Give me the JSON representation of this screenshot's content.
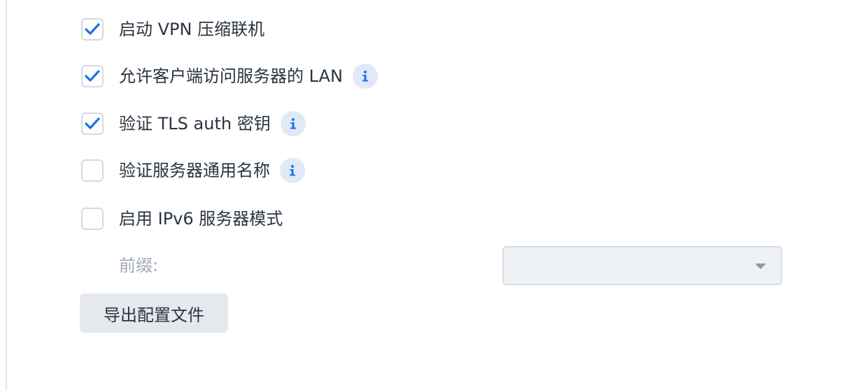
{
  "options": [
    {
      "label": "启动 VPN 压缩联机",
      "checked": true,
      "has_info": false
    },
    {
      "label": "允许客户端访问服务器的 LAN",
      "checked": true,
      "has_info": true
    },
    {
      "label": "验证 TLS auth 密钥",
      "checked": true,
      "has_info": true
    },
    {
      "label": "验证服务器通用名称",
      "checked": false,
      "has_info": true
    },
    {
      "label": "启用 IPv6 服务器模式",
      "checked": false,
      "has_info": false
    }
  ],
  "prefix": {
    "label": "前缀:",
    "value": ""
  },
  "export_button": {
    "label": "导出配置文件"
  },
  "icons": {
    "checkbox_tick": "check-icon",
    "info": "info-icon",
    "select_caret": "chevron-down-icon"
  },
  "colors": {
    "accent": "#1a73e8",
    "info_bg": "#dfe9f7",
    "button_bg": "#e5e9ee",
    "select_bg": "#eff2f5",
    "text": "#2b3440",
    "muted_text": "#a0a8b3"
  }
}
